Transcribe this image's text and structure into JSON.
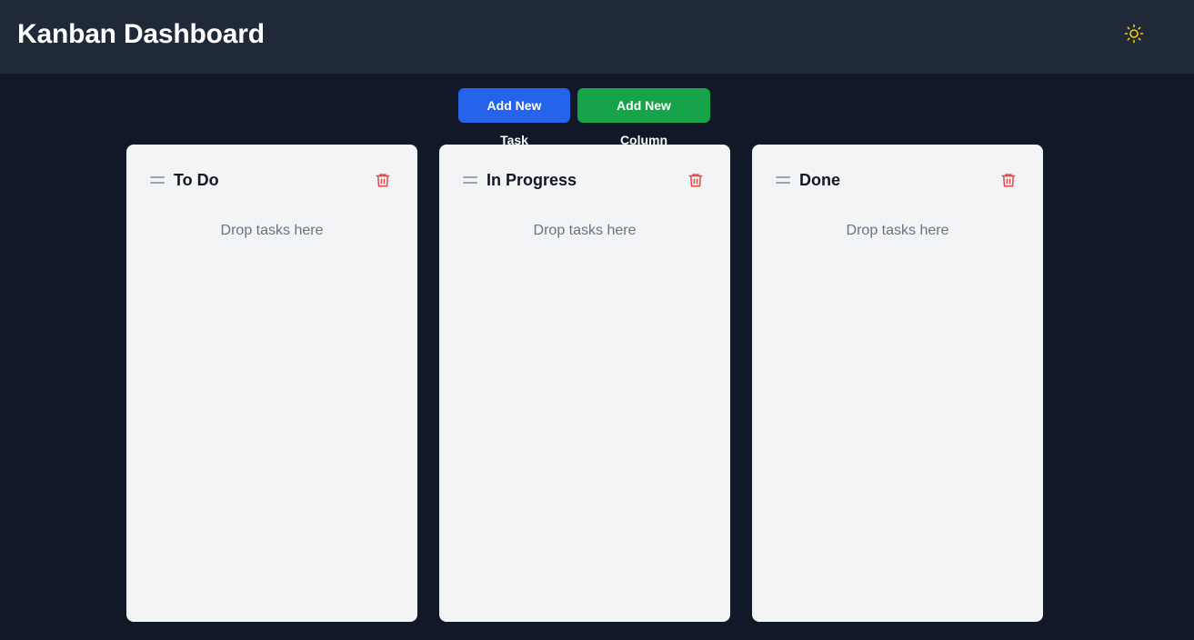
{
  "header": {
    "title": "Kanban Dashboard",
    "theme_icon": "sun-icon",
    "theme_icon_color": "#facc15"
  },
  "toolbar": {
    "add_task_label": "Add New Task",
    "add_column_label": "Add New Column",
    "add_task_color": "#2563eb",
    "add_column_color": "#16a34a"
  },
  "columns": [
    {
      "title": "To Do",
      "empty_text": "Drop tasks here"
    },
    {
      "title": "In Progress",
      "empty_text": "Drop tasks here"
    },
    {
      "title": "Done",
      "empty_text": "Drop tasks here"
    }
  ],
  "colors": {
    "background": "#111827",
    "header": "#1f2937",
    "column": "#f3f4f6",
    "delete": "#ef4444"
  }
}
